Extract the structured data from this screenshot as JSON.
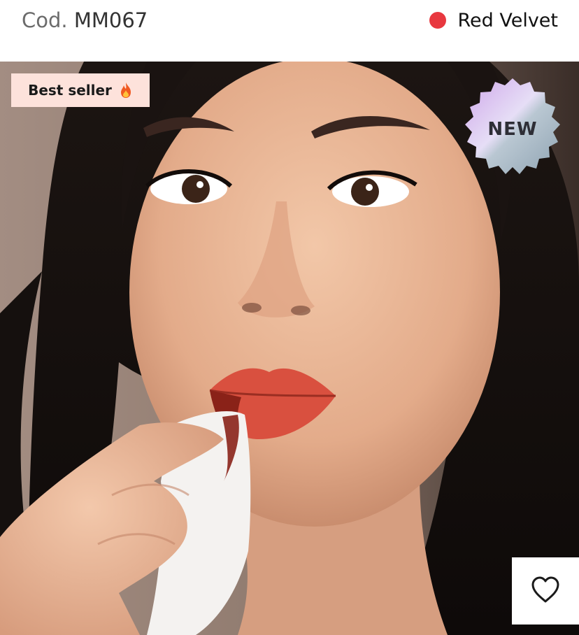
{
  "product": {
    "code_prefix": "Cod.",
    "code": "MM067",
    "shade_name": "Red Velvet",
    "shade_color": "#e8383f"
  },
  "image": {
    "subject": "model-wiping-red-lipstick-with-tissue"
  },
  "badges": {
    "best_seller_label": "Best seller",
    "best_seller_icon": "fire-icon",
    "new_label": "NEW"
  },
  "wishlist": {
    "icon": "heart-outline-icon"
  },
  "colors": {
    "best_seller_bg": "#fde2db",
    "new_badge_gradient": [
      "#c7a6e6",
      "#e4dcf5",
      "#9fb6c4"
    ],
    "background_tone": "#9a8377",
    "lip_color": "#d9503f"
  }
}
